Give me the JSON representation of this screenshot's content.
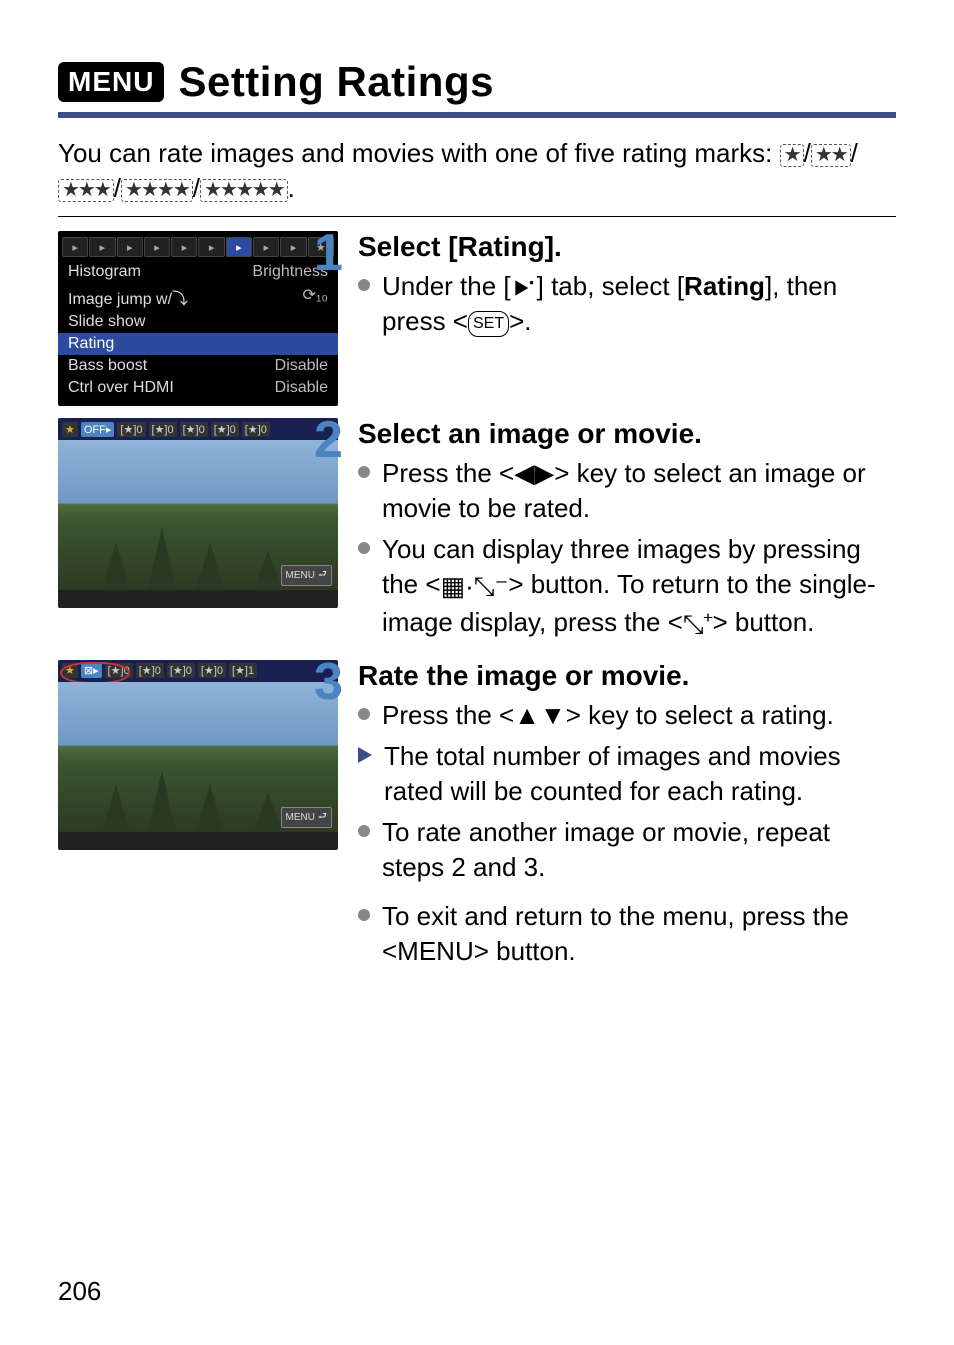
{
  "page_number": "206",
  "header": {
    "badge": "MENU",
    "title": "Setting Ratings"
  },
  "intro_text": "You can rate images and movies with one of five rating marks: ",
  "rating_marks": [
    "★",
    "★★",
    "★★★",
    "★★★★",
    "★★★★★"
  ],
  "menu_screenshot": {
    "tabs": [
      "▸",
      "▸",
      "▸",
      "▸",
      "▸",
      "▸",
      "▸",
      "▸",
      "▸",
      "★"
    ],
    "selected_tab_index": 6,
    "rows": [
      {
        "label": "Histogram",
        "value": "Brightness",
        "selected": false
      },
      {
        "label": "Image jump w/⤵",
        "value": "⟳₁₀",
        "selected": false
      },
      {
        "label": "Slide show",
        "value": "",
        "selected": false
      },
      {
        "label": "Rating",
        "value": "",
        "selected": true
      },
      {
        "label": "Bass boost",
        "value": "Disable",
        "selected": false
      },
      {
        "label": "Ctrl over HDMI",
        "value": "Disable",
        "selected": false
      }
    ]
  },
  "rating_bar_step2": [
    {
      "text": "★",
      "cls": "gold"
    },
    {
      "text": "OFF▸",
      "cls": "active"
    },
    {
      "text": "[★]0",
      "cls": ""
    },
    {
      "text": "[★]0",
      "cls": ""
    },
    {
      "text": "[★]0",
      "cls": ""
    },
    {
      "text": "[★]0",
      "cls": ""
    },
    {
      "text": "[★]0",
      "cls": ""
    }
  ],
  "rating_bar_step3": [
    {
      "text": "★",
      "cls": "gold"
    },
    {
      "text": "⊠▸",
      "cls": "active"
    },
    {
      "text": "[★]0",
      "cls": ""
    },
    {
      "text": "[★]0",
      "cls": ""
    },
    {
      "text": "[★]0",
      "cls": ""
    },
    {
      "text": "[★]0",
      "cls": ""
    },
    {
      "text": "[★]1",
      "cls": ""
    }
  ],
  "thumb_menu_label": "MENU",
  "steps": {
    "one": {
      "num": "1",
      "heading": "Select [Rating].",
      "line1a": "Under the [",
      "line1b": "] tab, select [",
      "line1c": "Rating",
      "line1d": "], then press <",
      "line1e": ">."
    },
    "two": {
      "num": "2",
      "heading": "Select an image or movie.",
      "b1": "Press the <◀▶> key to select an image or movie to be rated.",
      "b2a": "You can display three images by pressing the <",
      "b2b": "> button. To return to the single-image display, press the <",
      "b2c": "> button."
    },
    "three": {
      "num": "3",
      "heading": "Rate the image or movie.",
      "b1": "Press the <▲▼> key to select a rating.",
      "b2": "The total number of images and movies rated will be counted for each rating.",
      "b3": "To rate another image or movie, repeat steps 2 and 3.",
      "b4": "To exit and return to the menu, press the <MENU> button."
    }
  },
  "icons": {
    "set_btn": "SET",
    "grid_zoomout": "▦·⤡⁻",
    "zoomin": "⤡⁺"
  }
}
